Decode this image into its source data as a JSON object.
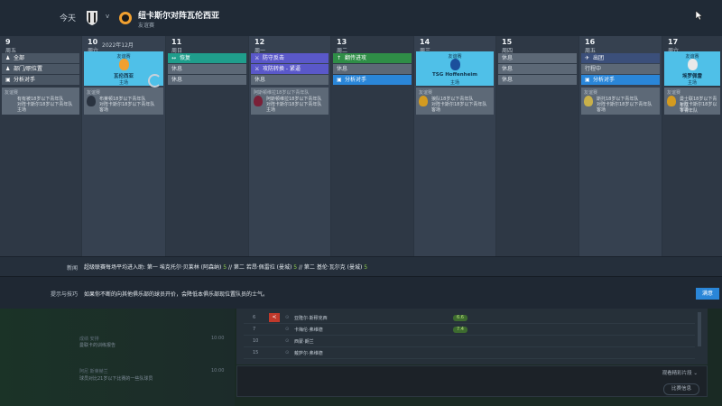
{
  "header": {
    "today": "今天",
    "vs": "v",
    "title": "纽卡斯尔对阵瓦伦西亚",
    "subtitle": "友谊赛"
  },
  "filters": {
    "items": [
      {
        "icon": "person-icon",
        "label": "全部"
      },
      {
        "icon": "team-icon",
        "label": "部门/职位置"
      },
      {
        "icon": "clipboard-icon",
        "label": "分析对手"
      }
    ]
  },
  "days": [
    {
      "d": "9",
      "w": "周五",
      "events": [],
      "note": {
        "l1": "友谊赛",
        "l2": "有有被18岁以下青年队",
        "l3": "对阵卡斯尔18岁以下青年队",
        "l4": "主场"
      }
    },
    {
      "d": "10",
      "w": "周六",
      "month": "2022年12月",
      "match": {
        "k": "友谊赛",
        "t": "瓦伦西亚",
        "v": "主场"
      },
      "note": {
        "l1": "友谊赛",
        "l2": "布莱顿18岁以下青年队",
        "l3": "对阵卡斯尔18岁以下青年队",
        "l4": "客场"
      }
    },
    {
      "d": "11",
      "w": "周日",
      "events": [
        {
          "c": "teal",
          "ic": "↔",
          "t": "恢复"
        },
        {
          "c": "gray",
          "t": "休息"
        },
        {
          "c": "gray",
          "t": "休息"
        }
      ]
    },
    {
      "d": "12",
      "w": "周一",
      "events": [
        {
          "c": "pur",
          "ic": "⚔",
          "t": "防守反击"
        },
        {
          "c": "pur",
          "ic": "⚔",
          "t": "攻防转换 - 紧逼"
        },
        {
          "c": "gray",
          "t": "休息"
        }
      ],
      "note": {
        "l1": "阿斯顿维拉18岁以下青年队",
        "l2": "阿斯顿维拉18岁以下青年队",
        "l3": "对阵卡斯尔18岁以下青年队",
        "l4": "主场"
      }
    },
    {
      "d": "13",
      "w": "周二",
      "events": [
        {
          "c": "grn",
          "ic": "↑",
          "t": "翻传进攻"
        },
        {
          "c": "gray",
          "t": "休息"
        },
        {
          "c": "blue",
          "ic": "▣",
          "t": "分析对手"
        }
      ]
    },
    {
      "d": "14",
      "w": "周三",
      "match": {
        "k": "友谊赛",
        "t": "TSG Hoffenheim",
        "v": "主场"
      },
      "note": {
        "l1": "友谊赛",
        "l2": "狼队18岁以下青年队",
        "l3": "对阵卡斯尔18岁以下青年队",
        "l4": "客场"
      }
    },
    {
      "d": "15",
      "w": "周四",
      "events": [
        {
          "c": "gray",
          "t": "休息"
        },
        {
          "c": "gray",
          "t": "休息"
        },
        {
          "c": "gray",
          "t": "休息"
        }
      ]
    },
    {
      "d": "16",
      "w": "周五",
      "events": [
        {
          "c": "navy",
          "ic": "✈",
          "t": "出团"
        },
        {
          "c": "gray",
          "t": "行程中"
        },
        {
          "c": "blue",
          "ic": "▣",
          "t": "分析对手"
        }
      ],
      "note": {
        "l1": "友谊赛",
        "l2": "斯托18岁以下青年队",
        "l3": "对阵卡斯尔18岁以下青年队",
        "l4": "客场"
      }
    },
    {
      "d": "17",
      "w": "周六",
      "match": {
        "k": "友谊赛",
        "t": "埃罗佩雷",
        "v": "主场"
      },
      "note": {
        "l1": "友谊赛",
        "l2": "曼士联18岁以下青年队",
        "l3": "对阵卡斯尔18岁以下青年队",
        "l4": "客场"
      }
    }
  ],
  "news": {
    "label": "新闻",
    "p1": "超级联赛每场平均进入助: 第一 埃克托尔·贝莱林 (阿森纳) ",
    "v1": "5",
    "p2": " // 第二 若昂·佩雷拉 (曼城) ",
    "v2": "5",
    "p3": " // 第二 基伦·瓦尔克 (曼城) ",
    "v3": "5"
  },
  "tip": {
    "label": "提示与技巧",
    "text": "如果你不断的向其他俱乐部的球员开价，会降低本俱乐部现位置队员的士气。",
    "button": "满意"
  },
  "sidebar": [
    {
      "s": "成绩 安排",
      "t": "曼联卡的训练报告",
      "time": "10:00"
    },
    {
      "s": "阿尼 斯莱赫兰",
      "t": "球员对比21岁以下比赛的一些队球员",
      "time": "10:00"
    }
  ],
  "squad": [
    {
      "n": "6",
      "flag": "<",
      "name": "亚隆尔·斯穆克西",
      "sc": "6.6"
    },
    {
      "n": "7",
      "name": "卡梅伦·弗维德",
      "sc": "7.4"
    },
    {
      "n": "10",
      "name": "西蒙·朗兰",
      "sc": ""
    },
    {
      "n": "15",
      "name": "戴萨尔·弗维德",
      "sc": ""
    }
  ],
  "bottom": {
    "dropdown": "观看精彩片段 ⌄",
    "button": "比赛信息"
  },
  "colors": {
    "match": "#4fc0e8",
    "accent": "#2a86d8",
    "teal": "#1f9e8c",
    "purple": "#5a58c9",
    "green": "#2f8e47"
  }
}
